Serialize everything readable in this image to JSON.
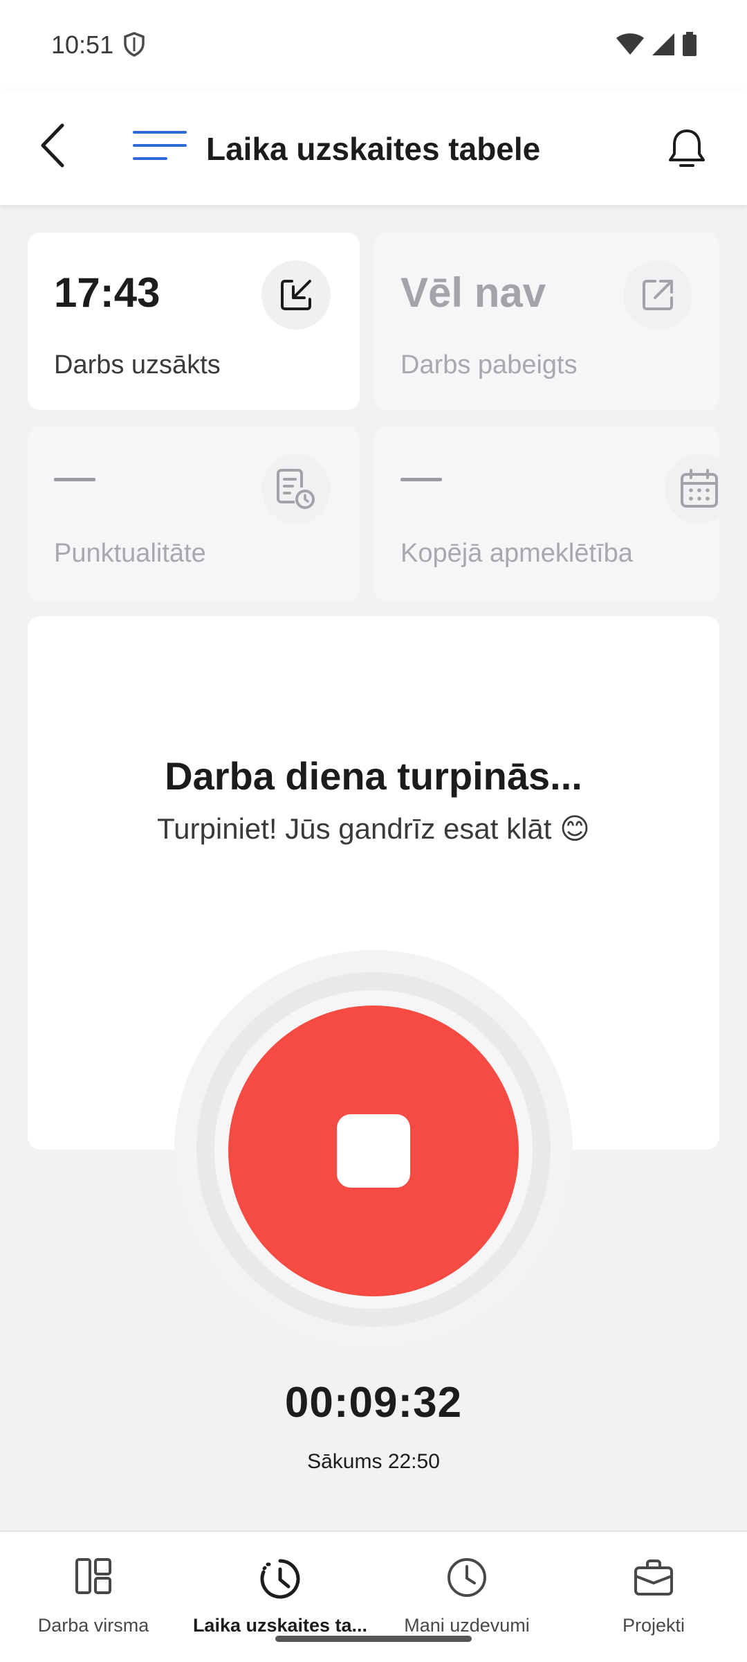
{
  "status_bar": {
    "time": "10:51"
  },
  "app_bar": {
    "title": "Laika uzskaites tabele"
  },
  "cards": {
    "work_started": {
      "value": "17:43",
      "label": "Darbs uzsākts"
    },
    "work_finished": {
      "value": "Vēl nav",
      "label": "Darbs pabeigts"
    },
    "punctuality": {
      "label": "Punktualitāte"
    },
    "attendance": {
      "label": "Kopējā apmeklētība"
    }
  },
  "main": {
    "title": "Darba diena turpinās...",
    "subtitle": "Turpiniet! Jūs gandrīz esat klāt 😊",
    "timer": "00:09:32",
    "start_time": "Sākums 22:50"
  },
  "bottom_nav": {
    "items": [
      {
        "label": "Darba virsma",
        "icon": "dashboard-icon"
      },
      {
        "label": "Laika uzskaites ta...",
        "icon": "clock-history-icon",
        "active": true
      },
      {
        "label": "Mani uzdevumi",
        "icon": "clock-icon"
      },
      {
        "label": "Projekti",
        "icon": "briefcase-icon"
      }
    ]
  },
  "colors": {
    "stop_button": "#f54b43",
    "menu_accent": "#2f6bd6",
    "background": "#f1f2f4"
  }
}
